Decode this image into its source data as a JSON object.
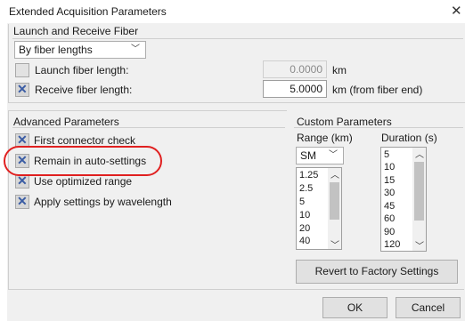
{
  "window": {
    "title": "Extended Acquisition Parameters",
    "close_glyph": "✕"
  },
  "launch": {
    "group_title": "Launch and Receive Fiber",
    "mode_value": "By fiber lengths",
    "launch_label": "Launch fiber length:",
    "launch_value": "0.0000",
    "launch_unit": "km",
    "launch_checked": false,
    "receive_label": "Receive fiber length:",
    "receive_value": "5.0000",
    "receive_unit": "km (from fiber end)",
    "receive_checked": true
  },
  "advanced": {
    "group_title": "Advanced Parameters",
    "items": [
      {
        "label": "First connector check",
        "checked": true
      },
      {
        "label": "Remain in auto-settings",
        "checked": true
      },
      {
        "label": "Use optimized range",
        "checked": true
      },
      {
        "label": "Apply settings by wavelength",
        "checked": true
      }
    ]
  },
  "custom": {
    "group_title": "Custom Parameters",
    "range_header": "Range (km)",
    "duration_header": "Duration (s)",
    "fiber_type": "SM",
    "ranges": [
      "1.25",
      "2.5",
      "5",
      "10",
      "20",
      "40"
    ],
    "durations": [
      "5",
      "10",
      "15",
      "30",
      "45",
      "60",
      "90",
      "120"
    ]
  },
  "buttons": {
    "revert": "Revert to Factory Settings",
    "ok": "OK",
    "cancel": "Cancel"
  },
  "colors": {
    "check_x": "#3a5ca4",
    "highlight": "#e02020"
  }
}
